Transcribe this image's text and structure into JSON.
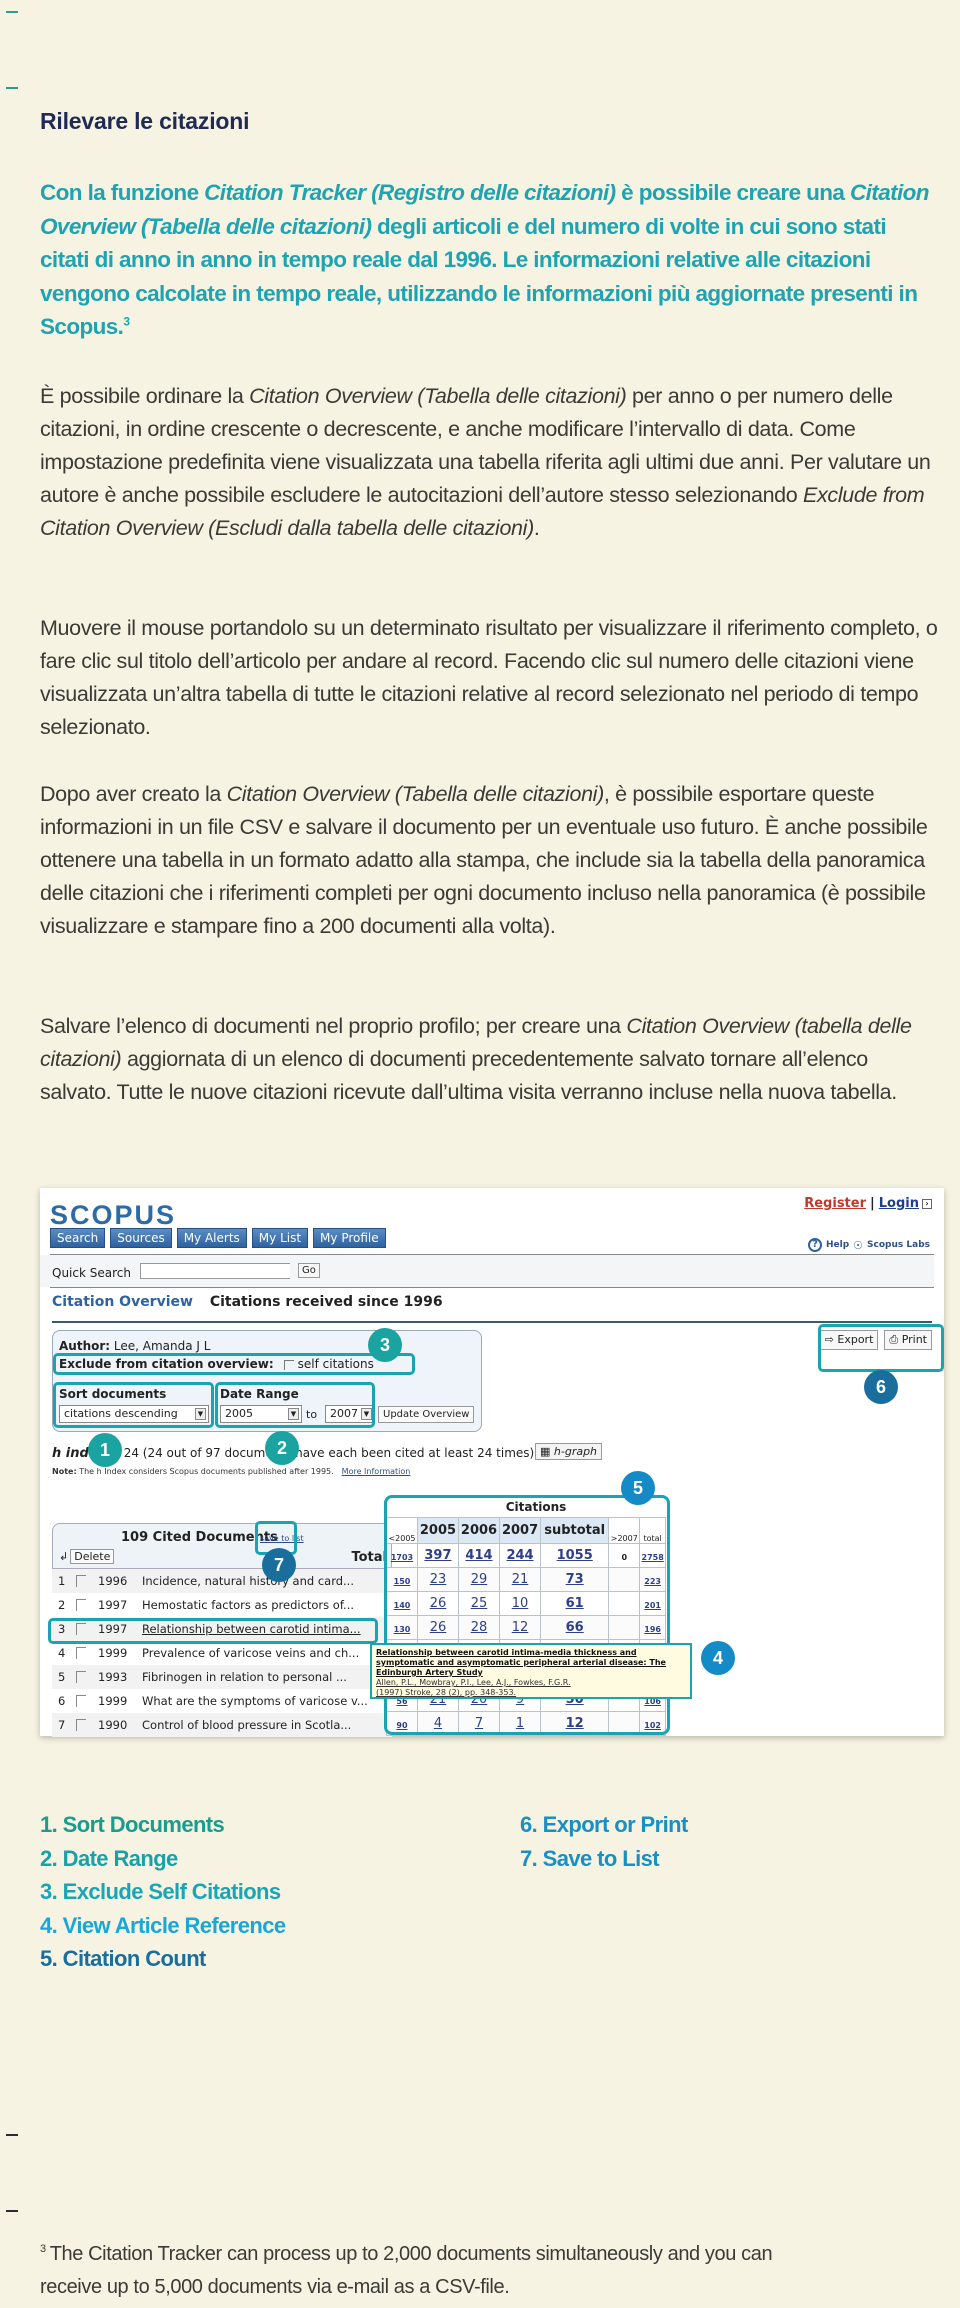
{
  "page": {
    "title": "Rilevare le citazioni",
    "lead": {
      "parts": [
        {
          "text": "Con la funzione ",
          "italic": false
        },
        {
          "text": "Citation Tracker (Registro delle citazioni)",
          "italic": true
        },
        {
          "text": " è possibile creare una ",
          "italic": false
        },
        {
          "text": "Citation Overview (Tabella delle citazioni)",
          "italic": true
        },
        {
          "text": " degli articoli e del numero di volte in cui sono stati citati di anno in anno in tempo reale dal 1996. Le informazioni relative alle citazioni vengono calcolate in tempo reale, utilizzando le informazioni più aggiornate presenti in Scopus.",
          "italic": false
        }
      ],
      "footnote_ref": "3"
    },
    "paragraphs": [
      [
        {
          "text": "È possibile ordinare la ",
          "italic": false
        },
        {
          "text": "Citation Overview (Tabella delle citazioni)",
          "italic": true
        },
        {
          "text": " per anno o per numero delle citazioni, in ordine crescente o decrescente, e anche modificare l’intervallo di data. Come impostazione predefinita viene visualizzata una tabella riferita agli ultimi due anni. Per valutare un autore è anche possibile escludere le autocitazioni dell’autore stesso selezionando ",
          "italic": false
        },
        {
          "text": "Exclude from Citation Overview (Escludi dalla tabella delle citazioni)",
          "italic": true
        },
        {
          "text": ".",
          "italic": false
        }
      ],
      [
        {
          "text": "Muovere il mouse portandolo su un determinato risultato per visualizzare il riferimento completo, o fare clic sul titolo dell’articolo per andare al record. Facendo clic sul numero delle citazioni viene visualizzata un’altra tabella di tutte le citazioni relative al record selezionato nel periodo di tempo selezionato.",
          "italic": false
        }
      ],
      [
        {
          "text": "Dopo aver creato la ",
          "italic": false
        },
        {
          "text": "Citation Overview (Tabella delle citazioni)",
          "italic": true
        },
        {
          "text": ", è possibile esportare queste informazioni in un file CSV e salvare il documento per un eventuale uso futuro. È anche possibile ottenere una tabella in un formato adatto alla stampa, che include sia la tabella della panoramica delle citazioni che i riferimenti completi per ogni documento incluso nella panoramica (è possibile visualizzare e stampare fino a 200 documenti alla volta).",
          "italic": false
        }
      ],
      [
        {
          "text": "Salvare l’elenco di documenti nel proprio profilo; per creare una ",
          "italic": false
        },
        {
          "text": "Citation Overview (tabella delle citazioni)",
          "italic": true
        },
        {
          "text": " aggiornata di un elenco di documenti precedentemente salvato tornare all’elenco salvato. Tutte le nuove citazioni ricevute dall’ultima visita verranno incluse nella nuova tabella.",
          "italic": false
        }
      ]
    ],
    "legend": {
      "left": [
        "1. Sort Documents",
        "2. Date Range",
        "3. Exclude Self Citations",
        "4. View Article Reference",
        "5.  Citation Count"
      ],
      "right": [
        "6.  Export or Print",
        "7.  Save to List"
      ],
      "colors": [
        "#1a9c8c",
        "#1aa1a8",
        "#1aa5b5",
        "#18a7d8",
        "#1a6e9e",
        "#1a8fc4",
        "#1a8fc4"
      ]
    },
    "footnote": {
      "ref": "3",
      "text": "The Citation Tracker can process up to 2,000 documents simultaneously and you can receive up to 5,000 documents via e-mail as a CSV-file."
    }
  },
  "screenshot": {
    "logo": "SCOPUS",
    "register": "Register",
    "separator": "|",
    "login": "Login",
    "nav_tabs": [
      "Search",
      "Sources",
      "My Alerts",
      "My List",
      "My Profile"
    ],
    "help": "Help",
    "labs": "Scopus Labs",
    "quick_search_label": "Quick Search",
    "quick_search_value": "",
    "go": "Go",
    "citation_overview": "Citation Overview",
    "citations_since": "Citations received since 1996",
    "author_label": "Author:",
    "author_name": "Lee, Amanda J L",
    "exclude_label": "Exclude from citation overview:",
    "self_citations": "self citations",
    "self_citations_checked": false,
    "sort_label": "Sort documents",
    "sort_value": "citations descending",
    "date_label": "Date Range",
    "date_from": "2005",
    "date_to_word": "to",
    "date_to": "2007",
    "update": "Update Overview",
    "h_index_label": "h index",
    "h_index_text": "= 24 (24 out of 97 documents have each been cited at least 24 times)",
    "h_graph": "h-graph",
    "note_label": "Note:",
    "note_text": "The h Index considers Scopus documents published after 1995.",
    "more_info": "More Information",
    "export": "Export",
    "print": "Print",
    "cited_docs": "109 Cited Documents",
    "save_to_list": "save to list",
    "delete": "Delete",
    "total_label": "Total",
    "citations_caption": "Citations",
    "columns": [
      "<2005",
      "2005",
      "2006",
      "2007",
      "subtotal",
      ">2007",
      "total"
    ],
    "totals": [
      "1703",
      "397",
      "414",
      "244",
      "1055",
      "0",
      "2758"
    ],
    "documents": [
      {
        "n": "1",
        "year": "1996",
        "title": "Incidence, natural history and card...",
        "cites": [
          "150",
          "23",
          "29",
          "21",
          "73",
          "",
          "223"
        ]
      },
      {
        "n": "2",
        "year": "1997",
        "title": "Hemostatic factors as predictors of...",
        "cites": [
          "140",
          "26",
          "25",
          "10",
          "61",
          "",
          "201"
        ]
      },
      {
        "n": "3",
        "year": "1997",
        "title": "Relationship between carotid intima...",
        "cites": [
          "130",
          "26",
          "28",
          "12",
          "66",
          "",
          "196"
        ]
      },
      {
        "n": "4",
        "year": "1999",
        "title": "Prevalence of varicose veins and ch...",
        "cites": [
          "",
          "",
          "",
          "",
          "",
          "",
          ""
        ]
      },
      {
        "n": "5",
        "year": "1993",
        "title": "Fibrinogen in relation to personal ...",
        "cites": [
          "",
          "",
          "",
          "",
          "",
          "",
          ""
        ]
      },
      {
        "n": "6",
        "year": "1999",
        "title": "What are the symptoms of varicose v...",
        "cites": [
          "56",
          "21",
          "20",
          "9",
          "50",
          "",
          "106"
        ]
      },
      {
        "n": "7",
        "year": "1990",
        "title": "Control of blood pressure in Scotla...",
        "cites": [
          "90",
          "4",
          "7",
          "1",
          "12",
          "",
          "102"
        ]
      }
    ],
    "tooltip": {
      "title": "Relationship between carotid intima-media thickness and symptomatic and asymptomatic peripheral arterial disease: The Edinburgh Artery Study",
      "authors": "Allen, P.L., Mowbray, P.I., Lee, A.J., Fowkes, F.G.R.",
      "source": "(1997) Stroke, 28 (2), pp. 348-353."
    },
    "badges": [
      "1",
      "2",
      "3",
      "4",
      "5",
      "6",
      "7"
    ]
  }
}
